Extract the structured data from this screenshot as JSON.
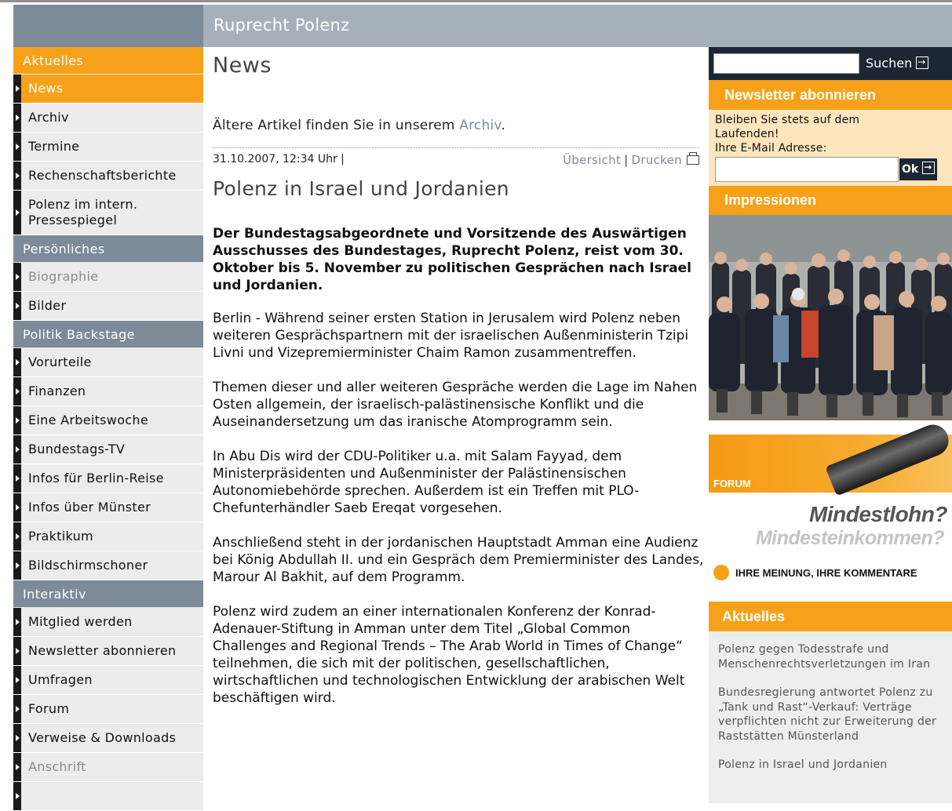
{
  "header": {
    "site_title": "Ruprecht Polenz"
  },
  "nav": {
    "sections": [
      {
        "label": "Aktuelles",
        "active": true,
        "items": [
          {
            "label": "News",
            "selected": true
          },
          {
            "label": "Archiv"
          },
          {
            "label": "Termine"
          },
          {
            "label": "Rechenschaftsberichte"
          },
          {
            "label": "Polenz im intern. Pressespiegel"
          }
        ]
      },
      {
        "label": "Persönliches",
        "items": [
          {
            "label": "Biographie",
            "dim": true
          },
          {
            "label": "Bilder"
          }
        ]
      },
      {
        "label": "Politik Backstage",
        "items": [
          {
            "label": "Vorurteile"
          },
          {
            "label": "Finanzen"
          },
          {
            "label": "Eine Arbeitswoche"
          },
          {
            "label": "Bundestags-TV"
          },
          {
            "label": "Infos für Berlin-Reise"
          },
          {
            "label": "Infos über Münster"
          },
          {
            "label": "Praktikum"
          },
          {
            "label": "Bildschirmschoner"
          }
        ]
      },
      {
        "label": "Interaktiv",
        "items": [
          {
            "label": "Mitglied werden"
          },
          {
            "label": "Newsletter abonnieren"
          },
          {
            "label": "Umfragen"
          },
          {
            "label": "Forum"
          },
          {
            "label": "Verweise & Downloads"
          },
          {
            "label": "Anschrift",
            "dim": true
          }
        ]
      }
    ]
  },
  "main": {
    "page_title": "News",
    "older_prefix": "Ältere Artikel finden Sie in unserem ",
    "older_link": "Archiv",
    "older_suffix": ".",
    "date": "31.10.2007, 12:34 Uhr |",
    "overview_link": "Übersicht",
    "print_link": "Drucken",
    "article_title": "Polenz in Israel und Jordanien",
    "lead": "Der Bundestagsabgeordnete und Vorsitzende des Auswärtigen Ausschusses des Bundestages, Ruprecht Polenz, reist vom 30. Oktober bis 5. November zu politischen Gesprächen nach Israel und Jordanien.",
    "paragraphs": [
      "Berlin - Während seiner ersten Station in Jerusalem wird Polenz neben weiteren Gesprächspartnern mit der israelischen Außenministerin Tzipi Livni und Vizepremierminister Chaim Ramon zusammentreffen.",
      "Themen dieser und aller weiteren Gespräche werden die Lage im Nahen Osten allgemein, der israelisch-palästinensische Konflikt und die Auseinandersetzung um das iranische Atomprogramm sein.",
      "In Abu Dis wird der CDU-Politiker u.a. mit Salam Fayyad, dem Ministerpräsidenten und Außenminister der Palästinensischen Autonomiebehörde sprechen. Außerdem ist ein Treffen mit PLO-Chefunterhändler Saeb Ereqat vorgesehen.",
      "Anschließend steht in der jordanischen Hauptstadt Amman eine Audienz bei König Abdullah II. und ein Gespräch dem Premierminister des Landes, Marour Al Bakhit, auf dem Programm.",
      "Polenz wird zudem an einer internationalen Konferenz der Konrad-Adenauer-Stiftung in Amman unter dem Titel „Global Common Challenges and Regional Trends – The Arab World in Times of Change“ teilnehmen, die sich mit der politischen, gesellschaftlichen, wirtschaftlichen und technologischen Entwicklung der arabischen Welt beschäftigen wird."
    ]
  },
  "right": {
    "search": {
      "button_label": "Suchen",
      "value": ""
    },
    "newsletter": {
      "heading": "Newsletter abonnieren",
      "text": "Bleiben Sie stets auf dem Laufenden!",
      "email_label": "Ihre E-Mail Adresse:",
      "ok_label": "Ok"
    },
    "impressions": {
      "heading": "Impressionen"
    },
    "forum": {
      "label": "FORUM",
      "headline1": "Mindestlohn?",
      "headline2": "Mindesteinkommen?",
      "cta": "IHRE MEINUNG, IHRE KOMMENTARE"
    },
    "aktuelles": {
      "heading": "Aktuelles",
      "items": [
        "Polenz gegen Todesstrafe und Menschenrechtsverletzungen im Iran",
        "Bundesregierung antwortet Polenz zu „Tank und Rast“-Verkauf: Verträge verpflichten nicht zur Erweiterung der Raststätten Münsterland",
        "Polenz in Israel und Jordanien"
      ]
    }
  },
  "colors": {
    "accent_orange": "#f7a11a",
    "nav_section_gray": "#7d8a97",
    "header_gray": "#a5b0bb",
    "search_dark": "#1c2733",
    "link_gray": "#7d8a97"
  }
}
